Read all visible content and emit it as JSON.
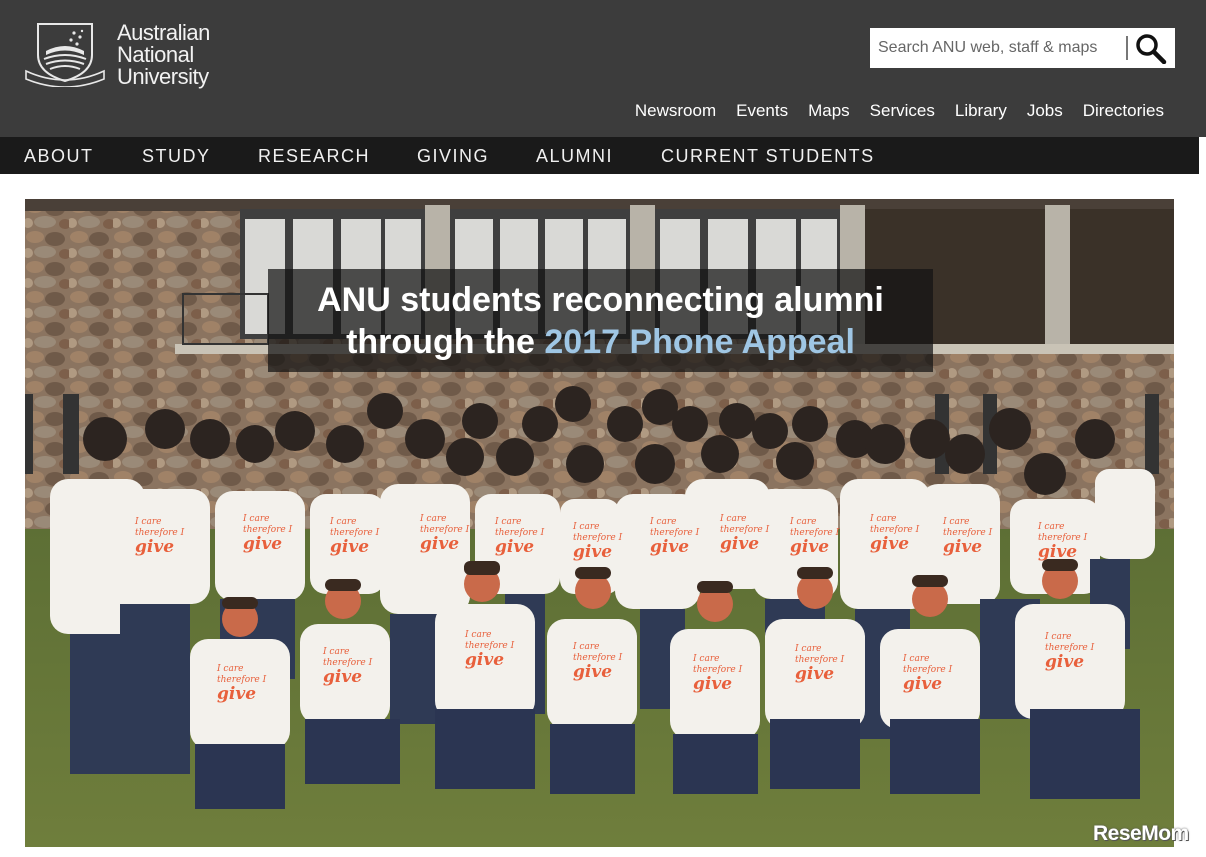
{
  "header": {
    "logo_lines": [
      "Australian",
      "National",
      "University"
    ],
    "search": {
      "placeholder": "Search ANU web, staff & maps",
      "value": ""
    },
    "utility_nav": [
      "Newsroom",
      "Events",
      "Maps",
      "Services",
      "Library",
      "Jobs",
      "Directories"
    ]
  },
  "main_nav": [
    "ABOUT",
    "STUDY",
    "RESEARCH",
    "GIVING",
    "ALUMNI",
    "CURRENT STUDENTS"
  ],
  "hero": {
    "caption_line1": "ANU students reconnecting alumni",
    "caption_line2_prefix": "through the ",
    "caption_line2_highlight": "2017 Phone Appeal",
    "shirt_text": [
      "I care",
      "therefore I",
      "give"
    ]
  },
  "watermark": "ReseMom",
  "colors": {
    "header_bg": "#3c3c3c",
    "nav_bg": "#1a1a1a",
    "highlight": "#9fc6e4",
    "shirt_print": "#e8603c"
  },
  "icons": [
    "search-icon",
    "anu-crest-icon"
  ]
}
